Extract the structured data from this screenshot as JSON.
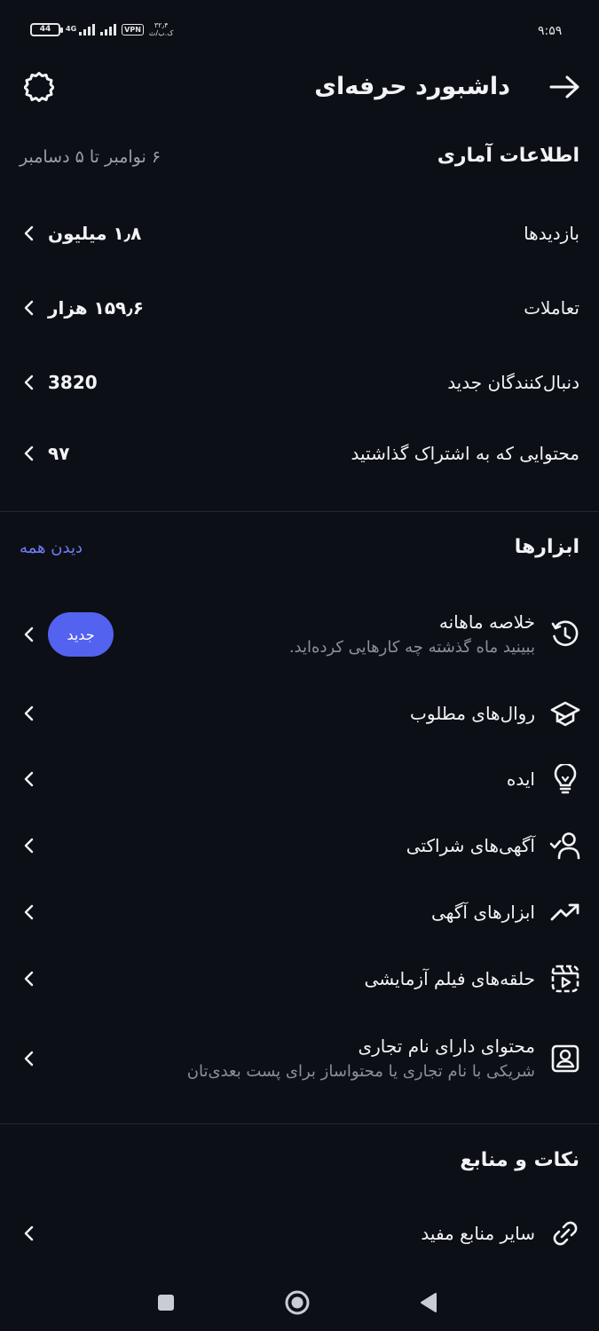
{
  "status_bar": {
    "time": "۹:۵۹",
    "battery": "44",
    "network": "4G",
    "vpn": "VPN",
    "speed_value": "۳۲٫۴",
    "speed_unit": "ک.ب/ث"
  },
  "header": {
    "title": "داشبورد حرفه‌ای",
    "back_icon": "arrow-back-icon",
    "settings_icon": "settings-gear-icon"
  },
  "stats": {
    "title": "اطلاعات آماری",
    "date_range": "۶ نوامبر تا ۵ دسامبر",
    "rows": [
      {
        "label": "بازدیدها",
        "value": "۱٫۸ میلیون"
      },
      {
        "label": "تعاملات",
        "value": "۱۵۹٫۶ هزار"
      },
      {
        "label": "دنبال‌کنندگان جدید",
        "value": "3820"
      },
      {
        "label": "محتوایی که به اشتراک گذاشتید",
        "value": "۹۷"
      }
    ]
  },
  "tools": {
    "title": "ابزارها",
    "see_all": "دیدن همه",
    "items": [
      {
        "title": "خلاصه ماهانه",
        "subtitle": "ببینید ماه گذشته چه کارهایی کرده‌اید.",
        "badge": "جدید",
        "icon": "history-clock-icon"
      },
      {
        "title": "روال‌های مطلوب",
        "icon": "graduation-cap-icon"
      },
      {
        "title": "ایده",
        "icon": "lightbulb-icon"
      },
      {
        "title": "آگهی‌های شراکتی",
        "icon": "person-check-icon"
      },
      {
        "title": "ابزارهای آگهی",
        "icon": "trending-up-icon"
      },
      {
        "title": "حلقه‌های فیلم آزمایشی",
        "icon": "reels-play-icon"
      },
      {
        "title": "محتوای دارای نام تجاری",
        "subtitle": "شریکی با نام تجاری یا محتواساز برای پست بعدی‌تان",
        "icon": "branded-portrait-icon"
      }
    ]
  },
  "resources": {
    "title": "نکات و منابع",
    "items": [
      {
        "title": "سایر منابع مفید",
        "icon": "link-icon"
      }
    ]
  },
  "nav": {
    "recents_icon": "square-recents-icon",
    "home_icon": "circle-home-icon",
    "back_icon": "triangle-back-icon"
  },
  "colors": {
    "background": "#0c0f16",
    "text": "#f2f3f5",
    "muted": "#9aa0a8",
    "accent": "#5462f0",
    "link": "#6f7df8"
  }
}
